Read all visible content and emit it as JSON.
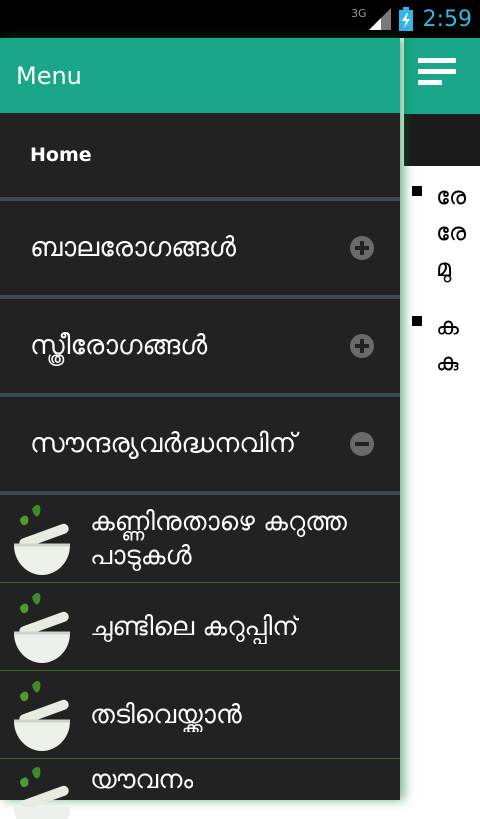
{
  "status_bar": {
    "network": "3G",
    "time": "2:59"
  },
  "drawer": {
    "title": "Menu",
    "home_label": "Home",
    "groups": [
      {
        "label": "ബാലരോഗങ്ങൾ",
        "state": "collapsed"
      },
      {
        "label": "സ്ത്രീരോഗങ്ങൾ",
        "state": "collapsed"
      },
      {
        "label": "സൗന്ദര്യവർദ്ധനവിന്",
        "state": "expanded"
      }
    ],
    "children": [
      {
        "label": "കണ്ണിനുതാഴെ കറുത്ത പാടുകൾ"
      },
      {
        "label": "ചുണ്ടിലെ കറുപ്പിന്"
      },
      {
        "label": "തടിവെയ്ക്കാൻ"
      },
      {
        "label": "യൗവനം"
      }
    ]
  },
  "content": {
    "items": [
      {
        "text": "രേ\nരേ\nമു"
      },
      {
        "text": "ക\nകു"
      }
    ]
  },
  "colors": {
    "accent": "#1aa789",
    "drawer_bg": "#222222",
    "status_time": "#33b5e5"
  }
}
